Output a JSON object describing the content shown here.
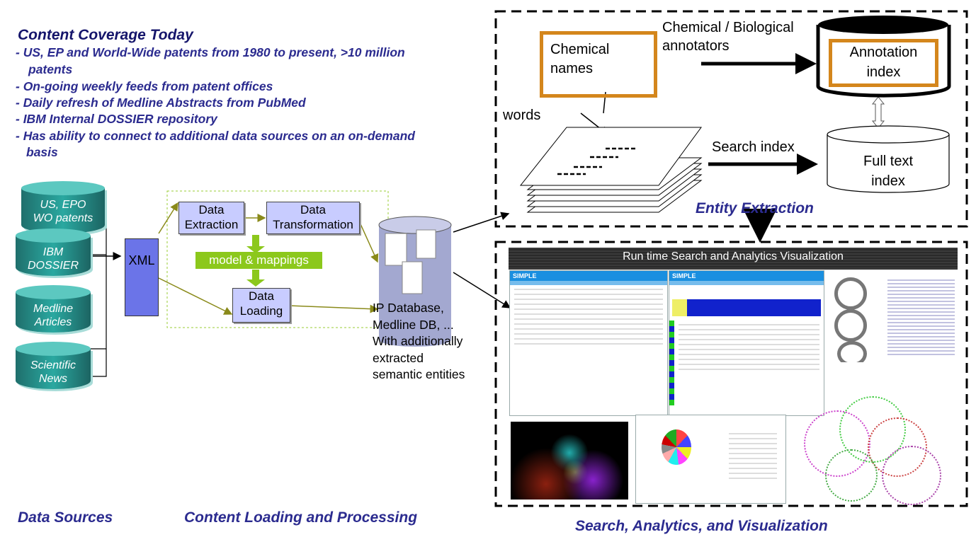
{
  "coverage": {
    "title": "Content Coverage Today",
    "bullets": [
      "- US, EP and World-Wide patents from 1980 to present, >10 million",
      "patents",
      "- On-going weekly feeds from patent offices",
      "- Daily refresh of Medline Abstracts from PubMed",
      "- IBM Internal DOSSIER repository",
      "- Has ability to connect to additional data sources on an on-demand",
      "basis"
    ]
  },
  "sources": [
    {
      "line1": "US, EPO",
      "line2": "WO patents"
    },
    {
      "line1": "IBM",
      "line2": "DOSSIER"
    },
    {
      "line1": "Medline",
      "line2": "Articles"
    },
    {
      "line1": "Scientific",
      "line2": "News"
    }
  ],
  "processing": {
    "xml": "XML",
    "extraction": [
      "Data",
      "Extraction"
    ],
    "transformation": [
      "Data",
      "Transformation"
    ],
    "mappings": "model & mappings",
    "loading": [
      "Data",
      "Loading"
    ]
  },
  "database_caption": [
    "IP Database,",
    "Medline DB, ...",
    "With additionally",
    "extracted",
    "semantic entities"
  ],
  "entity": {
    "chemical_names": [
      "Chemical",
      "names"
    ],
    "annotators": [
      "Chemical / Biological",
      "annotators"
    ],
    "annotation_index": [
      "Annotation",
      "index"
    ],
    "words": "words",
    "search_index": "Search index",
    "full_text_index": [
      "Full text",
      "index"
    ],
    "title": "Entity Extraction"
  },
  "visualization": {
    "banner": "Run time Search and Analytics Visualization",
    "app_name": "SIMPLE"
  },
  "footer": {
    "data_sources": "Data Sources",
    "content_loading": "Content Loading and Processing",
    "search_analytics": "Search, Analytics, and Visualization"
  },
  "colors": {
    "navy": "#2b2b8f",
    "teal": "#2aa8a0",
    "orange": "#d4861c",
    "green": "#8cc81c",
    "box": "#c8ccff"
  }
}
